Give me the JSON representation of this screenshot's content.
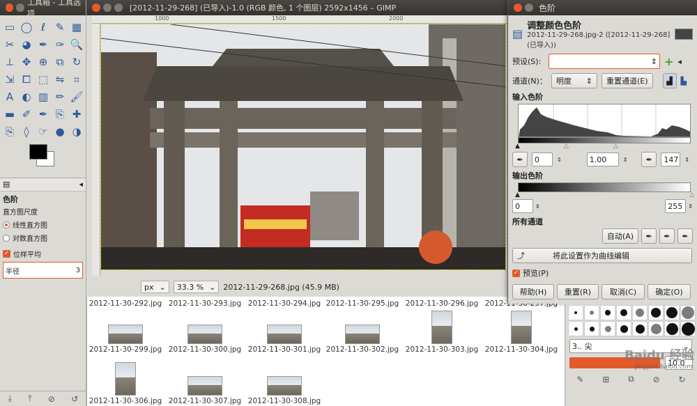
{
  "toolbox": {
    "title": "工具箱 - 工具选项",
    "tools": [
      "rect-select-icon",
      "ellipse-select-icon",
      "free-select-icon",
      "fuzzy-select-icon",
      "color-select-icon",
      "scissors-icon",
      "foreground-select-icon",
      "paths-icon",
      "color-picker-icon",
      "zoom-icon",
      "measure-icon",
      "move-icon",
      "align-icon",
      "crop-icon",
      "rotate-icon",
      "scale-icon",
      "shear-icon",
      "perspective-icon",
      "flip-icon",
      "cage-icon",
      "text-icon",
      "bucket-fill-icon",
      "blend-icon",
      "pencil-icon",
      "paintbrush-icon",
      "eraser-icon",
      "airbrush-icon",
      "ink-icon",
      "clone-icon",
      "heal-icon",
      "perspective-clone-icon",
      "blur-icon",
      "smudge-icon",
      "dodge-icon",
      "burn-icon"
    ],
    "tool_glyphs": [
      "▭",
      "◯",
      "ℓ",
      "✎",
      "▦",
      "✂",
      "◕",
      "✒",
      "✑",
      "🔍",
      "⟂",
      "✥",
      "⊕",
      "⧉",
      "↻",
      "⇲",
      "⧠",
      "⬚",
      "⇋",
      "⌗",
      "A",
      "◐",
      "▥",
      "✏",
      "🖌",
      "▬",
      "✐",
      "✒",
      "⎘",
      "✚",
      "⎘",
      "◊",
      "☞",
      "●",
      "◑"
    ],
    "options_title": "色阶",
    "hist_scale_label": "直方图尺度",
    "linear_hist": "线性直方图",
    "log_hist": "对数直方图",
    "sample_average": "位样平均",
    "radius_label": "半径",
    "radius_value": "3"
  },
  "image_window": {
    "title": "[2012-11-29-268] (已导入)-1.0 (RGB 颜色, 1 个图层) 2592x1456 – GIMP",
    "unit": "px",
    "zoom": "33.3 %",
    "status": "2012-11-29-268.jpg (45.9 MB)",
    "ruler_h": [
      "1000",
      "1500",
      "2000"
    ],
    "ruler_v": [
      "5",
      "1",
      "1",
      "5"
    ]
  },
  "browser": {
    "files_row1": [
      "2012-11-30-292.jpg",
      "2012-11-30-293.jpg",
      "2012-11-30-294.jpg",
      "2012-11-30-295.jpg",
      "2012-11-30-296.jpg",
      "2012-11-30-297.jpg"
    ],
    "files_row2": [
      "2012-11-30-299.jpg",
      "2012-11-30-300.jpg",
      "2012-11-30-301.jpg",
      "2012-11-30-302.jpg",
      "2012-11-30-303.jpg",
      "2012-11-30-304.jpg"
    ],
    "files_row3": [
      "2012-11-30-306.jpg",
      "2012-11-30-307.jpg",
      "2012-11-30-308.jpg"
    ]
  },
  "levels": {
    "title": "色阶",
    "heading": "调整颜色色阶",
    "subtitle": "2012-11-29-268.jpg-2 ([2012-11-29-268] (已导入))",
    "preset_label": "预设(S):",
    "preset_value": "",
    "channel_label": "通道(N)：",
    "channel_value": "明度",
    "reset_channel": "重置通道(E)",
    "input_levels": "输入色阶",
    "input_low": "0",
    "input_gamma": "1.00",
    "input_high": "147",
    "output_levels": "输出色阶",
    "output_low": "0",
    "output_high": "255",
    "all_channels": "所有通道",
    "auto": "自动(A)",
    "edit_curves": "将此设置作为曲线编辑",
    "preview": "预览(P)",
    "help": "帮助(H)",
    "reset": "重置(R)",
    "cancel": "取消(C)",
    "ok": "确定(O)"
  },
  "brushes": {
    "size_value": "10.0",
    "mode_label": "3.. 尖"
  },
  "watermark": "Baidu 经验",
  "watermark_url": "jingyan.baidu.com",
  "colors": {
    "accent": "#e05a2a",
    "titlebar": "#3c3b37"
  }
}
